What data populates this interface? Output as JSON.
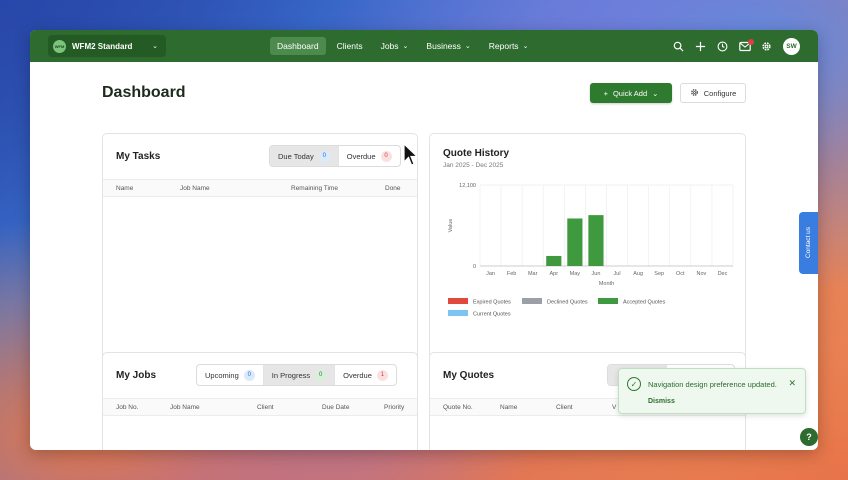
{
  "app": {
    "org_logo_text": "WFM",
    "org_name": "WFM2 Standard"
  },
  "nav": {
    "items": [
      {
        "label": "Dashboard",
        "active": true,
        "dropdown": false
      },
      {
        "label": "Clients",
        "active": false,
        "dropdown": false
      },
      {
        "label": "Jobs",
        "active": false,
        "dropdown": true
      },
      {
        "label": "Business",
        "active": false,
        "dropdown": true
      },
      {
        "label": "Reports",
        "active": false,
        "dropdown": true
      }
    ]
  },
  "top_icons": [
    "search-icon",
    "plus-icon",
    "clock-icon",
    "mail-icon",
    "gear-icon"
  ],
  "user": {
    "initials": "SW"
  },
  "page": {
    "title": "Dashboard",
    "quick_add_label": "Quick Add",
    "configure_label": "Configure"
  },
  "my_tasks": {
    "title": "My Tasks",
    "tabs": [
      {
        "label": "Due Today",
        "count": "0",
        "color": "blue",
        "active": true
      },
      {
        "label": "Overdue",
        "count": "0",
        "color": "red",
        "active": false
      }
    ],
    "columns": [
      "Name",
      "Job Name",
      "Remaining Time",
      "Done"
    ]
  },
  "quote_history": {
    "title": "Quote History",
    "subtitle": "Jan 2025 - Dec 2025"
  },
  "chart_data": {
    "type": "bar",
    "categories": [
      "Jan",
      "Feb",
      "Mar",
      "Apr",
      "May",
      "Jun",
      "Jul",
      "Aug",
      "Sep",
      "Oct",
      "Nov",
      "Dec"
    ],
    "series": [
      {
        "name": "Expired Quotes",
        "color": "#e04a3c",
        "values": [
          0,
          0,
          0,
          0,
          0,
          0,
          0,
          0,
          0,
          0,
          0,
          0
        ]
      },
      {
        "name": "Declined Quotes",
        "color": "#9aa0a6",
        "values": [
          0,
          0,
          0,
          0,
          0,
          0,
          0,
          0,
          0,
          0,
          0,
          0
        ]
      },
      {
        "name": "Accepted Quotes",
        "color": "#3f9a3f",
        "values": [
          0,
          0,
          0,
          1500,
          7100,
          7600,
          0,
          0,
          0,
          0,
          0,
          0
        ]
      },
      {
        "name": "Current Quotes",
        "color": "#7cc4f2",
        "values": [
          0,
          0,
          0,
          0,
          0,
          0,
          0,
          0,
          0,
          0,
          0,
          0
        ]
      }
    ],
    "ylabel": "Value",
    "xlabel": "Month",
    "ylim": [
      0,
      12100
    ],
    "yticks": [
      "0",
      "12,100"
    ],
    "legend": "bottom"
  },
  "my_jobs": {
    "title": "My Jobs",
    "tabs": [
      {
        "label": "Upcoming",
        "count": "0",
        "color": "blue",
        "active": false
      },
      {
        "label": "In Progress",
        "count": "0",
        "color": "green",
        "active": true
      },
      {
        "label": "Overdue",
        "count": "1",
        "color": "red",
        "active": false
      }
    ],
    "columns": [
      "Job No.",
      "Job Name",
      "Client",
      "Due Date",
      "Priority"
    ]
  },
  "my_quotes": {
    "title": "My Quotes",
    "columns": [
      "Quote No.",
      "Name",
      "Client",
      "V"
    ]
  },
  "toast": {
    "message": "Navigation design preference updated.",
    "dismiss_label": "Dismiss"
  },
  "contact_us": "Contact us",
  "help": "?"
}
